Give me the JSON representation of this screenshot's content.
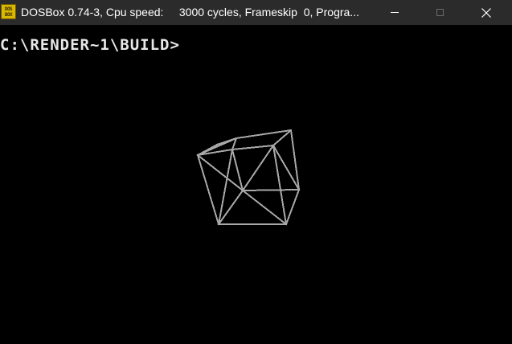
{
  "window": {
    "title": "DOSBox 0.74-3, Cpu speed:     3000 cycles, Frameskip  0, Progra...",
    "icon_top": "DOS",
    "icon_bottom": "BOX",
    "icon_name": "dosbox-icon",
    "controls": {
      "minimize": "minimize-icon",
      "maximize": "maximize-icon",
      "close": "close-icon"
    }
  },
  "console": {
    "prompt": "C:\\RENDER~1\\BUILD>",
    "background": "#000000",
    "text_color": "#e8e8e8",
    "wireframe_color": "#a8a8a8"
  }
}
